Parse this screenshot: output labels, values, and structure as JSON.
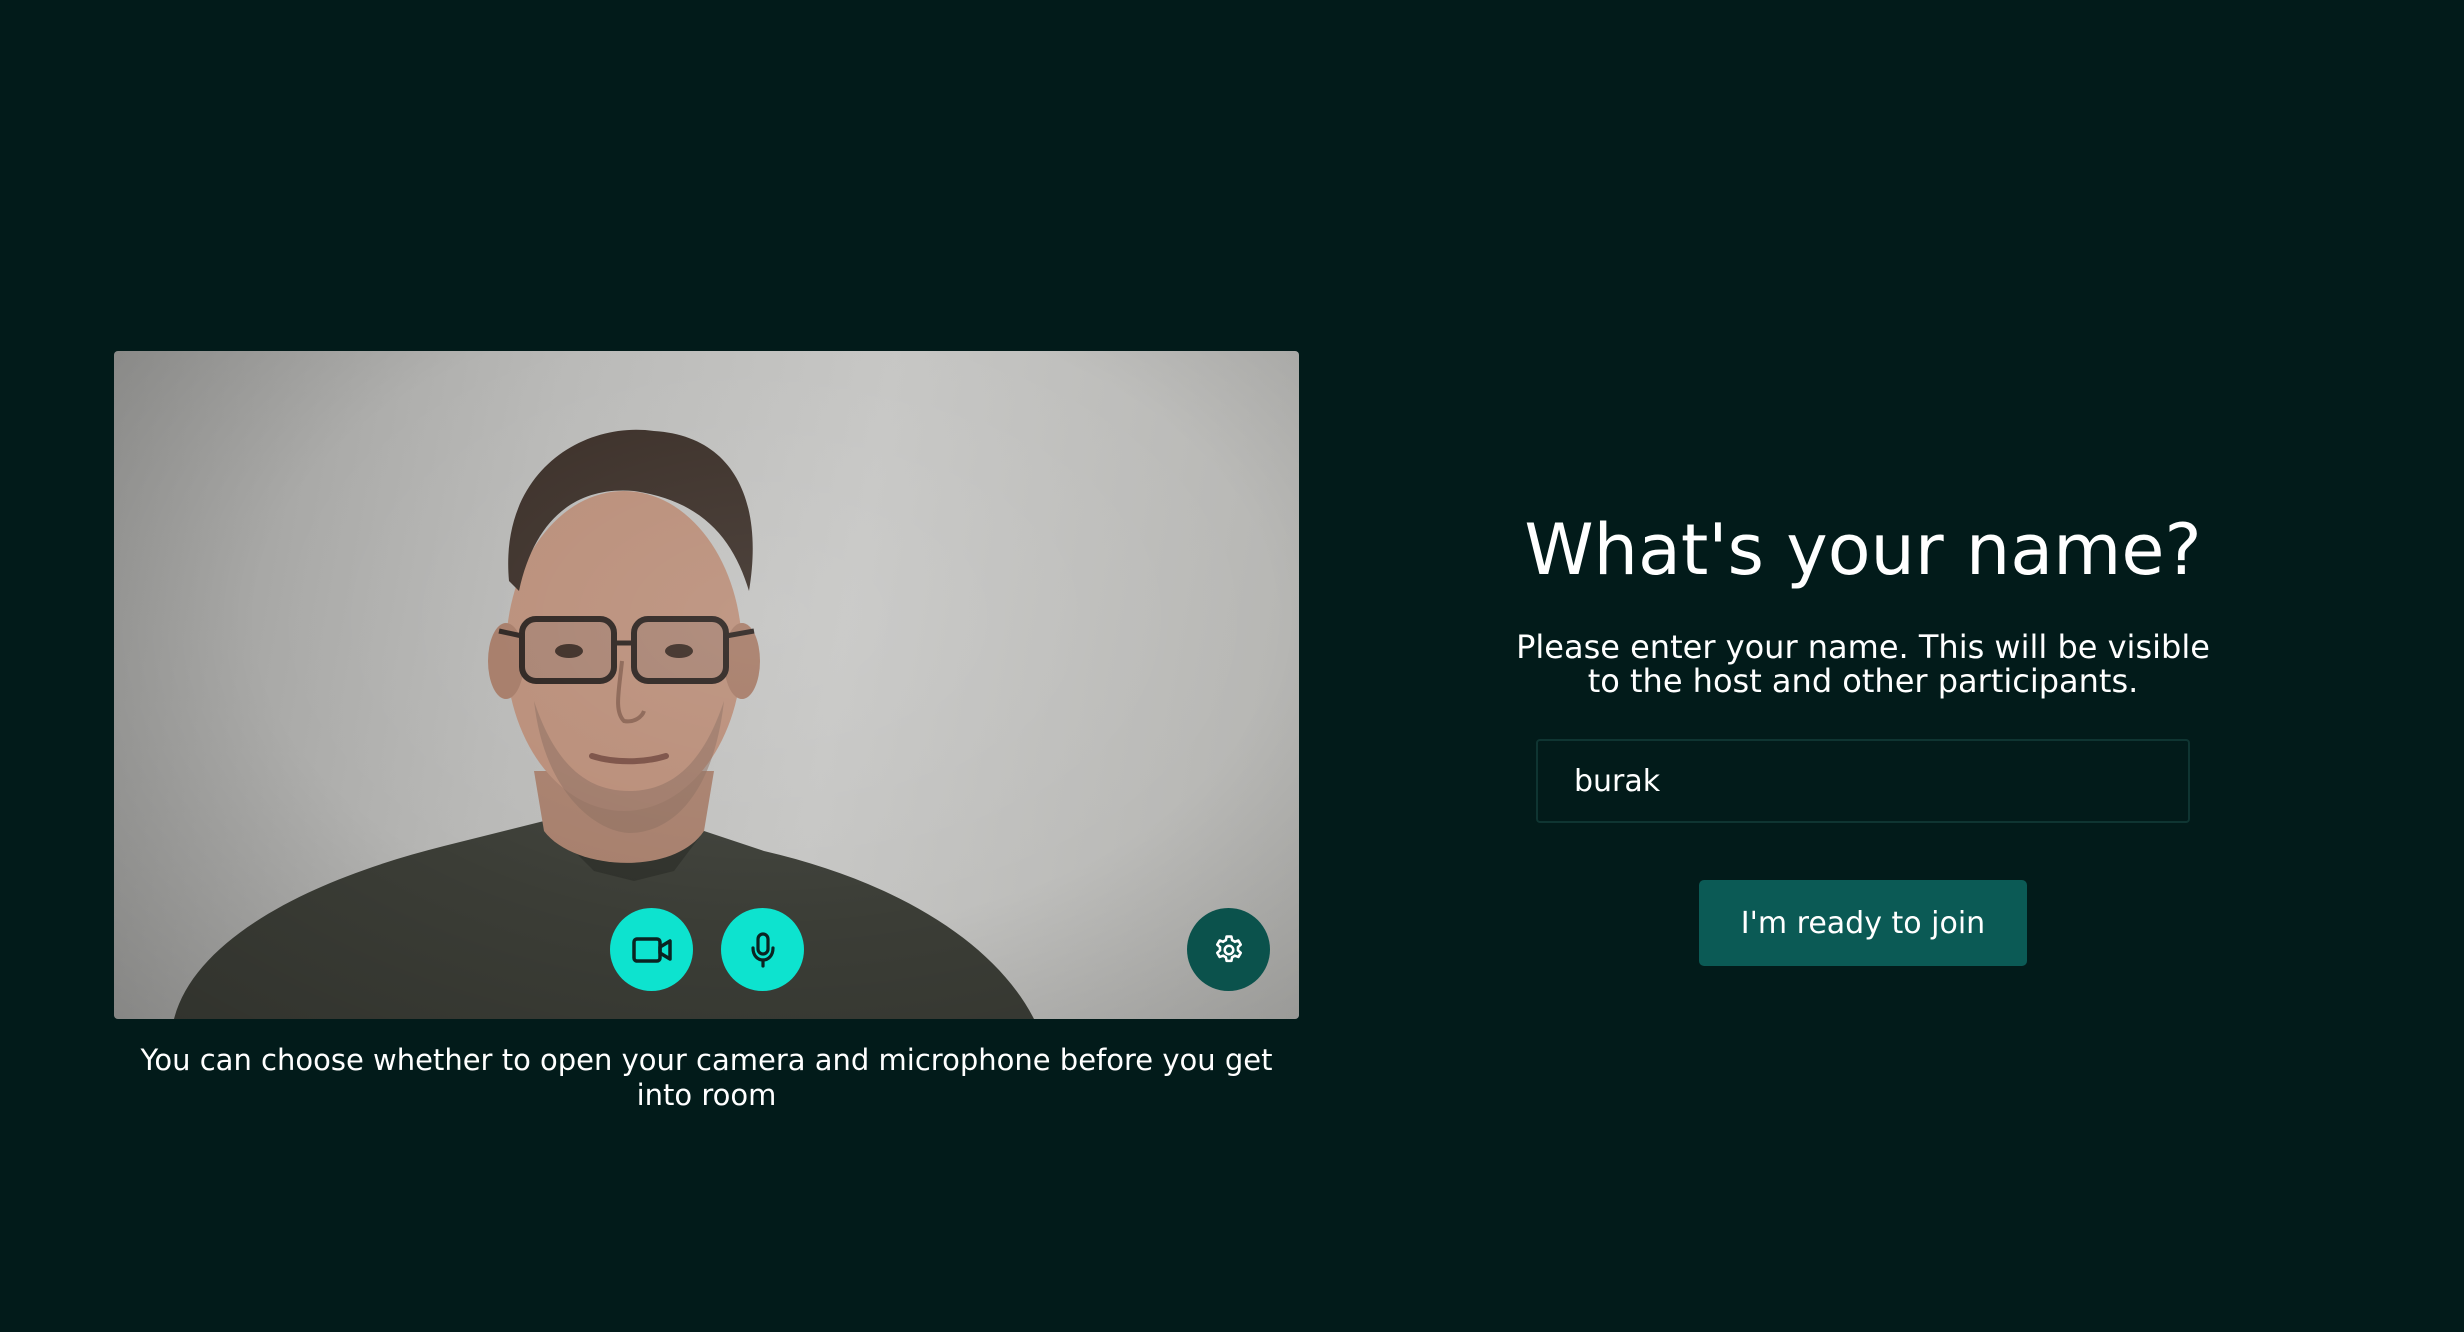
{
  "preview": {
    "camera_icon": "video-camera-icon",
    "microphone_icon": "microphone-icon",
    "settings_icon": "gear-icon",
    "caption": "You can choose whether to open your camera and microphone before you get into room"
  },
  "form": {
    "title": "What's your name?",
    "subtitle": "Please enter your name. This will be visible to the host and other participants.",
    "name_value": "burak",
    "join_label": "I'm ready to join"
  },
  "colors": {
    "background": "#021b1a",
    "control_active": "#0de3cf",
    "settings_button": "#0b524c",
    "join_button": "#0b5a55",
    "input_border": "#0f3532"
  }
}
